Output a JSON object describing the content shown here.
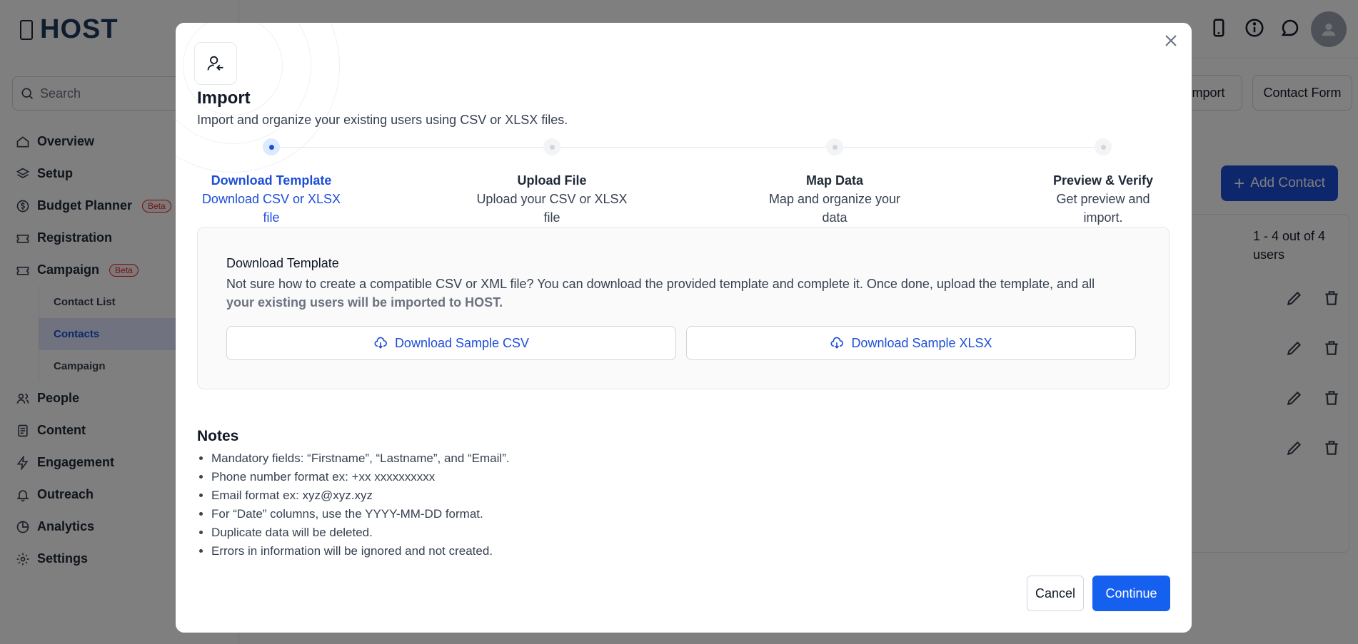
{
  "app": {
    "logo_text": "HOST",
    "search_placeholder": "Search"
  },
  "sidebar": {
    "items": [
      {
        "label": "Overview",
        "icon": "home-icon"
      },
      {
        "label": "Setup",
        "icon": "layers-icon"
      },
      {
        "label": "Budget Planner",
        "icon": "dollar-circle-icon",
        "badge": "Beta"
      },
      {
        "label": "Registration",
        "icon": "ticket-icon"
      },
      {
        "label": "Campaign",
        "icon": "ticket-icon",
        "badge": "Beta"
      }
    ],
    "sub_items": [
      {
        "label": "Contact List"
      },
      {
        "label": "Contacts",
        "active": true
      },
      {
        "label": "Campaign"
      }
    ],
    "items_after": [
      {
        "label": "People",
        "icon": "people-icon"
      },
      {
        "label": "Content",
        "icon": "document-icon"
      },
      {
        "label": "Engagement",
        "icon": "lightning-icon"
      },
      {
        "label": "Outreach",
        "icon": "bell-icon"
      },
      {
        "label": "Analytics",
        "icon": "pie-chart-icon"
      },
      {
        "label": "Settings",
        "icon": "gear-icon"
      }
    ]
  },
  "background": {
    "import_btn": "Import",
    "contact_form_btn": "Contact Form",
    "add_contact_btn": "Add Contact",
    "count_text": "1 - 4 out of 4 users"
  },
  "modal": {
    "title": "Import",
    "subtitle": "Import and organize your existing users using CSV or XLSX files.",
    "steps": [
      {
        "title": "Download Template",
        "desc": "Download CSV or XLSX file",
        "active": true
      },
      {
        "title": "Upload File",
        "desc": "Upload your CSV or XLSX file"
      },
      {
        "title": "Map Data",
        "desc": "Map and organize your data"
      },
      {
        "title": "Preview & Verify",
        "desc": "Get preview and import."
      }
    ],
    "template_box": {
      "title": "Download Template",
      "desc_prefix": "Not sure how to create a compatible CSV or XML file? You can download the provided template and complete it. Once done, upload the template, and all",
      "desc_bold": "your existing users will be imported to HOST.",
      "csv_btn": "Download Sample CSV",
      "xlsx_btn": "Download Sample XLSX"
    },
    "notes_title": "Notes",
    "notes": [
      "Mandatory fields: “Firstname”, “Lastname”, and “Email”.",
      "Phone number format ex: +xx xxxxxxxxxx",
      "Email format ex: xyz@xyz.xyz",
      "For “Date” columns, use the YYYY-MM-DD format.",
      "Duplicate data will be deleted.",
      "Errors in information will be ignored and not created."
    ],
    "cancel_btn": "Cancel",
    "continue_btn": "Continue"
  },
  "colors": {
    "primary": "#1660f0",
    "accent": "#1d4ed8",
    "beta_badge": "#dc2626"
  }
}
